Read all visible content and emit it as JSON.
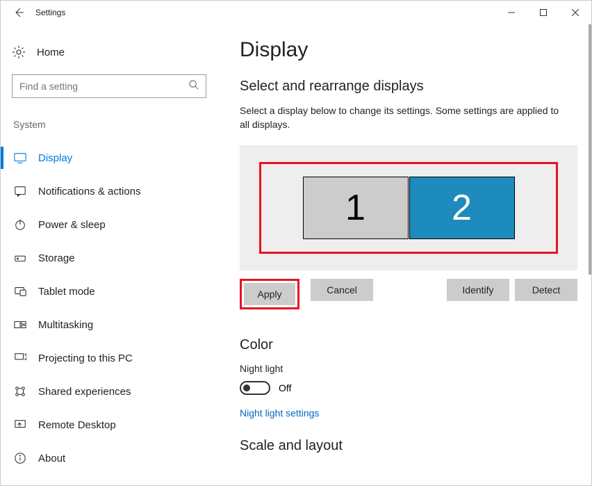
{
  "window": {
    "title": "Settings"
  },
  "sidebar": {
    "home": "Home",
    "search_placeholder": "Find a setting",
    "group": "System",
    "items": [
      {
        "id": "display",
        "label": "Display",
        "active": true
      },
      {
        "id": "notifications",
        "label": "Notifications & actions"
      },
      {
        "id": "power",
        "label": "Power & sleep"
      },
      {
        "id": "storage",
        "label": "Storage"
      },
      {
        "id": "tablet",
        "label": "Tablet mode"
      },
      {
        "id": "multitasking",
        "label": "Multitasking"
      },
      {
        "id": "projecting",
        "label": "Projecting to this PC"
      },
      {
        "id": "shared",
        "label": "Shared experiences"
      },
      {
        "id": "remote",
        "label": "Remote Desktop"
      },
      {
        "id": "about",
        "label": "About"
      }
    ]
  },
  "page": {
    "title": "Display",
    "select_heading": "Select and rearrange displays",
    "select_body": "Select a display below to change its settings. Some settings are applied to all displays.",
    "monitors": {
      "m1": "1",
      "m2": "2"
    },
    "buttons": {
      "apply": "Apply",
      "cancel": "Cancel",
      "identify": "Identify",
      "detect": "Detect"
    },
    "color_heading": "Color",
    "night_light_label": "Night light",
    "night_light_state": "Off",
    "night_light_link": "Night light settings",
    "scale_heading": "Scale and layout"
  },
  "highlight_color": "#e81123"
}
